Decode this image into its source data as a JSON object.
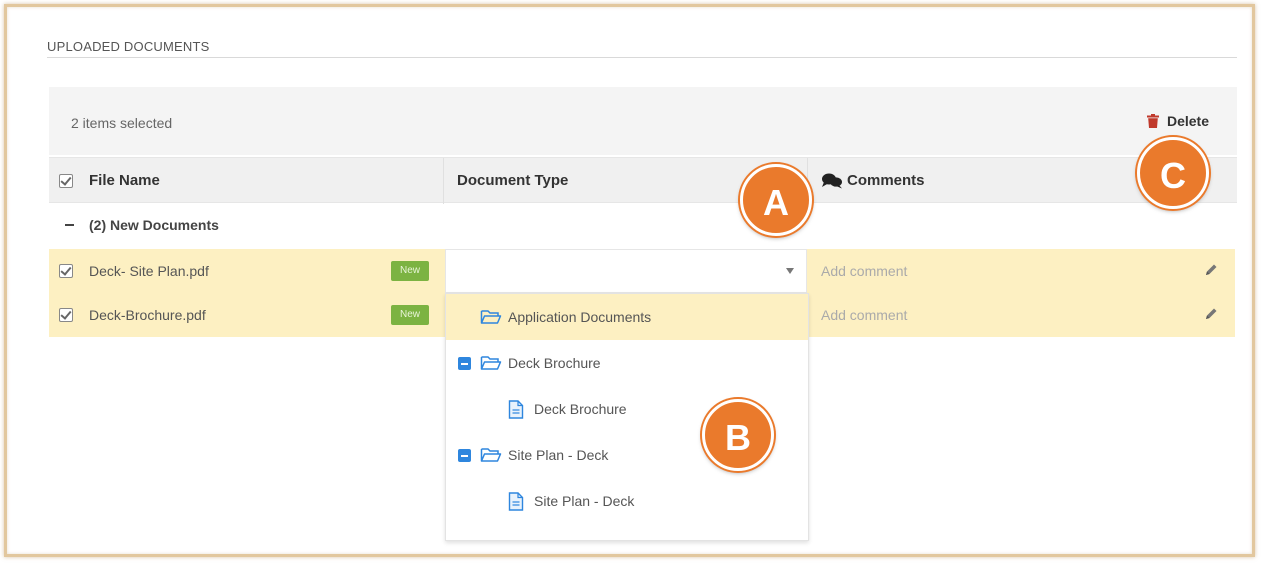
{
  "section": {
    "title": "UPLOADED DOCUMENTS"
  },
  "toolbar": {
    "selected_count": "2 items selected",
    "delete_label": "Delete"
  },
  "table": {
    "headers": {
      "file_name": "File Name",
      "document_type": "Document Type",
      "comments": "Comments"
    },
    "group_label": "(2) New Documents",
    "rows": [
      {
        "file_name": "Deck- Site Plan.pdf",
        "badge": "New",
        "comment_placeholder": "Add comment",
        "checked": true
      },
      {
        "file_name": "Deck-Brochure.pdf",
        "badge": "New",
        "comment_placeholder": "Add comment",
        "checked": true
      }
    ]
  },
  "dropdown": {
    "selected_value": "",
    "items": [
      {
        "label": "Application Documents",
        "icon": "folder-icon",
        "highlighted": true
      },
      {
        "label": "Deck Brochure",
        "icon": "folder-icon",
        "collapsible": true
      },
      {
        "label": "Deck Brochure",
        "icon": "document-icon"
      },
      {
        "label": "Site Plan - Deck",
        "icon": "folder-icon",
        "collapsible": true
      },
      {
        "label": "Site Plan - Deck",
        "icon": "document-icon"
      }
    ]
  },
  "callouts": {
    "a": "A",
    "b": "B",
    "c": "C"
  },
  "colors": {
    "row_highlight": "#fdf0c2",
    "badge_green": "#7cb342",
    "callout_orange": "#ea7a2c",
    "delete_red": "#c0392b",
    "tree_blue": "#2e86de"
  }
}
